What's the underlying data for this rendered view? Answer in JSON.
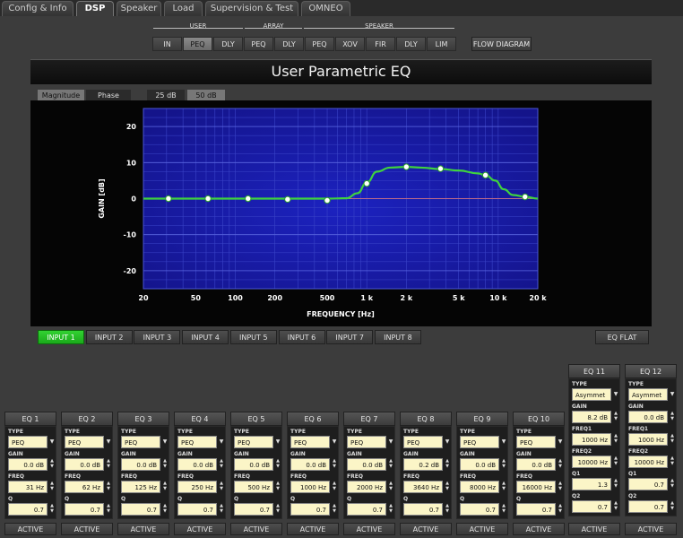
{
  "tabs": [
    {
      "label": "Config & Info",
      "x": 2,
      "w": 80
    },
    {
      "label": "DSP",
      "x": 85,
      "w": 42,
      "active": true
    },
    {
      "label": "Speaker",
      "x": 130,
      "w": 50
    },
    {
      "label": "Load",
      "x": 183,
      "w": 43
    },
    {
      "label": "Supervision & Test",
      "x": 229,
      "w": 104
    },
    {
      "label": "OMNEO",
      "x": 336,
      "w": 55
    }
  ],
  "blocks": {
    "groups": [
      {
        "label": "USER",
        "x": 171,
        "w": 100
      },
      {
        "label": "ARRAY",
        "x": 273,
        "w": 64
      },
      {
        "label": "SPEAKER",
        "x": 339,
        "w": 168
      }
    ],
    "items": [
      {
        "label": "IN",
        "x": 170
      },
      {
        "label": "PEQ",
        "x": 204,
        "selected": true
      },
      {
        "label": "DLY",
        "x": 238
      },
      {
        "label": "PEQ",
        "x": 272
      },
      {
        "label": "DLY",
        "x": 306
      },
      {
        "label": "PEQ",
        "x": 340
      },
      {
        "label": "XOV",
        "x": 374
      },
      {
        "label": "FIR",
        "x": 408
      },
      {
        "label": "DLY",
        "x": 442
      },
      {
        "label": "LIM",
        "x": 476
      }
    ],
    "flow_label": "FLOW DIAGRAM"
  },
  "title": "User Parametric EQ",
  "view": {
    "magnitude": "Magnitude",
    "phase": "Phase",
    "range_25": "25 dB",
    "range_50": "50 dB"
  },
  "chart_data": {
    "type": "line",
    "xlabel": "FREQUENCY [Hz]",
    "ylabel": "GAIN [dB]",
    "x_scale": "log",
    "xlim": [
      20,
      20000
    ],
    "ylim": [
      -25,
      25
    ],
    "x_ticks": [
      {
        "v": 20,
        "label": "20"
      },
      {
        "v": 50,
        "label": "50"
      },
      {
        "v": 100,
        "label": "100"
      },
      {
        "v": 200,
        "label": "200"
      },
      {
        "v": 500,
        "label": "500"
      },
      {
        "v": 1000,
        "label": "1 k"
      },
      {
        "v": 2000,
        "label": "2 k"
      },
      {
        "v": 5000,
        "label": "5 k"
      },
      {
        "v": 10000,
        "label": "10 k"
      },
      {
        "v": 20000,
        "label": "20 k"
      }
    ],
    "y_ticks": [
      20,
      10,
      0,
      -10,
      -20
    ],
    "grid": true,
    "series": [
      {
        "x": [
          20,
          31,
          62,
          125,
          250,
          500,
          700,
          850,
          1000,
          1200,
          1500,
          2000,
          2600,
          3640,
          5000,
          7000,
          8000,
          9500,
          11000,
          13000,
          16000,
          20000
        ],
        "y": [
          0,
          0,
          0,
          0,
          0,
          0,
          0.1,
          1.5,
          4.5,
          7.5,
          8.6,
          8.8,
          8.6,
          8.2,
          7.8,
          7.0,
          6.5,
          5.0,
          2.6,
          1.0,
          0.5,
          0
        ]
      }
    ],
    "points": [
      {
        "x": 31,
        "y": 0
      },
      {
        "x": 62,
        "y": 0
      },
      {
        "x": 125,
        "y": 0
      },
      {
        "x": 250,
        "y": -0.2
      },
      {
        "x": 500,
        "y": -0.5
      },
      {
        "x": 1000,
        "y": 4.2
      },
      {
        "x": 2000,
        "y": 8.8
      },
      {
        "x": 3640,
        "y": 8.3
      },
      {
        "x": 8000,
        "y": 6.5
      },
      {
        "x": 16000,
        "y": 0.5
      }
    ]
  },
  "inputs": {
    "items": [
      "INPUT 1",
      "INPUT 2",
      "INPUT 3",
      "INPUT 4",
      "INPUT 5",
      "INPUT 6",
      "INPUT 7",
      "INPUT 8"
    ],
    "eq_flat": "EQ FLAT"
  },
  "eq_labels": {
    "type": "TYPE",
    "gain": "GAIN",
    "freq": "FREQ",
    "q": "Q",
    "freq1": "FREQ1",
    "freq2": "FREQ2",
    "q1": "Q1",
    "q2": "Q2",
    "active": "ACTIVE"
  },
  "eq_bands": [
    {
      "name": "EQ 1",
      "type": "PEQ",
      "gain": "0.0 dB",
      "freq": "31 Hz",
      "q": "0.7"
    },
    {
      "name": "EQ 2",
      "type": "PEQ",
      "gain": "0.0 dB",
      "freq": "62 Hz",
      "q": "0.7"
    },
    {
      "name": "EQ 3",
      "type": "PEQ",
      "gain": "0.0 dB",
      "freq": "125 Hz",
      "q": "0.7"
    },
    {
      "name": "EQ 4",
      "type": "PEQ",
      "gain": "0.0 dB",
      "freq": "250 Hz",
      "q": "0.7"
    },
    {
      "name": "EQ 5",
      "type": "PEQ",
      "gain": "0.0 dB",
      "freq": "500 Hz",
      "q": "0.7"
    },
    {
      "name": "EQ 6",
      "type": "PEQ",
      "gain": "0.0 dB",
      "freq": "1000 Hz",
      "q": "0.7"
    },
    {
      "name": "EQ 7",
      "type": "PEQ",
      "gain": "0.0 dB",
      "freq": "2000 Hz",
      "q": "0.7"
    },
    {
      "name": "EQ 8",
      "type": "PEQ",
      "gain": "0.2 dB",
      "freq": "3640 Hz",
      "q": "0.7"
    },
    {
      "name": "EQ 9",
      "type": "PEQ",
      "gain": "0.0 dB",
      "freq": "8000 Hz",
      "q": "0.7"
    },
    {
      "name": "EQ 10",
      "type": "PEQ",
      "gain": "0.0 dB",
      "freq": "16000 Hz",
      "q": "0.7"
    }
  ],
  "eq_asym": [
    {
      "name": "EQ 11",
      "type": "Asymmet",
      "gain": "8.2 dB",
      "freq1": "1000 Hz",
      "freq2": "10000 Hz",
      "q1": "1.3",
      "q2": "0.7"
    },
    {
      "name": "EQ 12",
      "type": "Asymmet",
      "gain": "0.0 dB",
      "freq1": "1000 Hz",
      "freq2": "10000 Hz",
      "q1": "0.7",
      "q2": "0.7"
    }
  ],
  "colors": {
    "plot_bg": "#14148a",
    "curve": "#3fd23f",
    "grid": "#3a44c8",
    "active_input": "#22c022"
  }
}
